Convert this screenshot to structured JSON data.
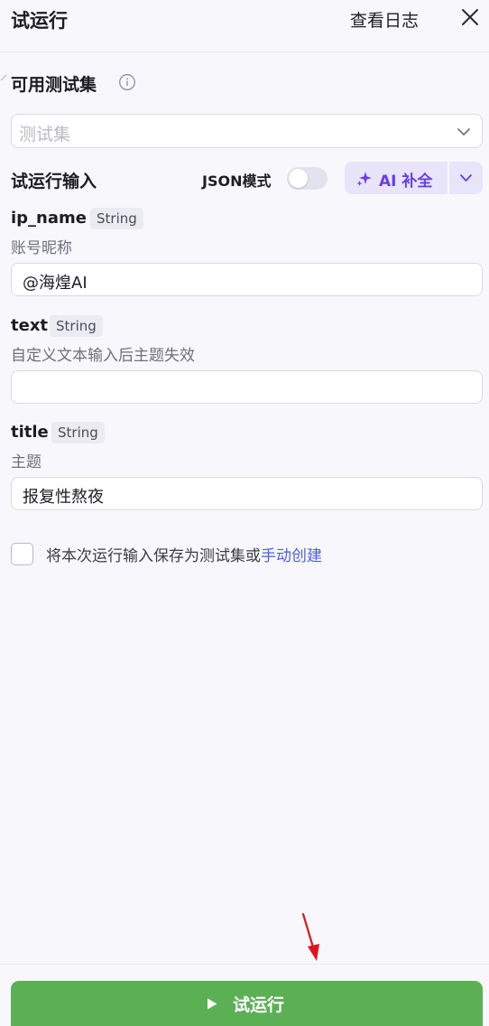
{
  "header": {
    "title": "试运行",
    "view_log": "查看日志"
  },
  "testset": {
    "label": "可用测试集",
    "placeholder": "测试集"
  },
  "run_input": {
    "label": "试运行输入",
    "json_mode_label": "JSON模式",
    "json_mode_on": false,
    "ai_complete_label": "AI 补全"
  },
  "fields": [
    {
      "name": "ip_name",
      "type": "String",
      "description": "账号昵称",
      "value": "@海煌AI"
    },
    {
      "name": "text",
      "type": "String",
      "description": "自定义文本输入后主题失效",
      "value": ""
    },
    {
      "name": "title",
      "type": "String",
      "description": "主题",
      "value": "报复性熬夜"
    }
  ],
  "save": {
    "checked": false,
    "text": "将本次运行输入保存为测试集或",
    "link": "手动创建"
  },
  "footer": {
    "run_label": "试运行"
  },
  "colors": {
    "accent_purple": "#6b3ee0",
    "run_green": "#5cb054",
    "link_blue": "#4e5de0",
    "annotation_red": "#e0141e"
  }
}
